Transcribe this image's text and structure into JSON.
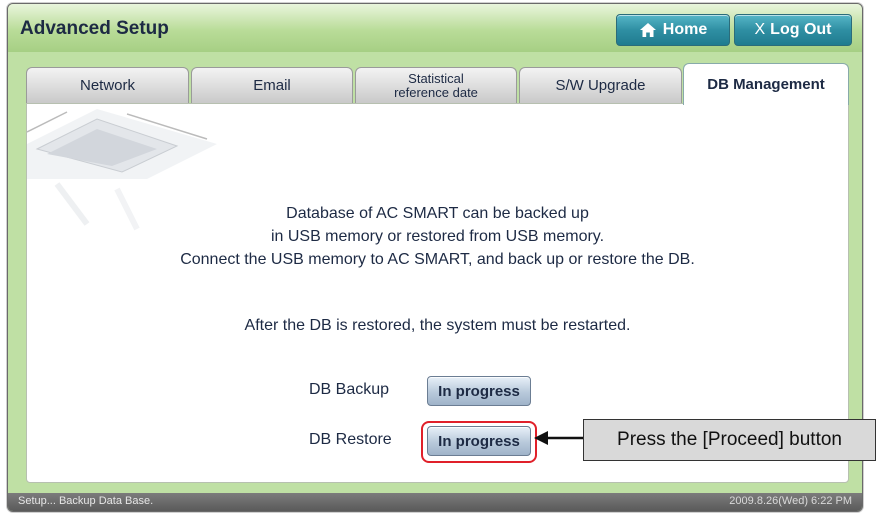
{
  "window": {
    "title": "Advanced Setup"
  },
  "header": {
    "home_label": "Home",
    "logout_label": "Log Out",
    "logout_prefix": "X"
  },
  "tabs": [
    {
      "label": "Network",
      "active": false
    },
    {
      "label": "Email",
      "active": false
    },
    {
      "label": "Statistical reference date",
      "line1": "Statistical",
      "line2": "reference date",
      "active": false
    },
    {
      "label": "S/W Upgrade",
      "active": false
    },
    {
      "label": "DB Management",
      "active": true
    }
  ],
  "content": {
    "lines": [
      "Database of AC SMART can be backed up",
      "in USB memory or restored from USB memory.",
      "Connect the USB memory to AC SMART, and back up or restore the DB."
    ],
    "restart_note": "After the DB is restored, the system must be restarted.",
    "backup": {
      "label": "DB Backup",
      "button": "In progress"
    },
    "restore": {
      "label": "DB Restore",
      "button": "In progress"
    }
  },
  "status": {
    "left": "Setup... Backup Data Base.",
    "right": "2009.8.26(Wed)  6:22 PM"
  },
  "annotation": {
    "text": "Press the [Proceed] button"
  },
  "colors": {
    "highlight": "#e0202a",
    "button_teal": "#2f8fa3",
    "title_bg": "#b9dc98"
  }
}
